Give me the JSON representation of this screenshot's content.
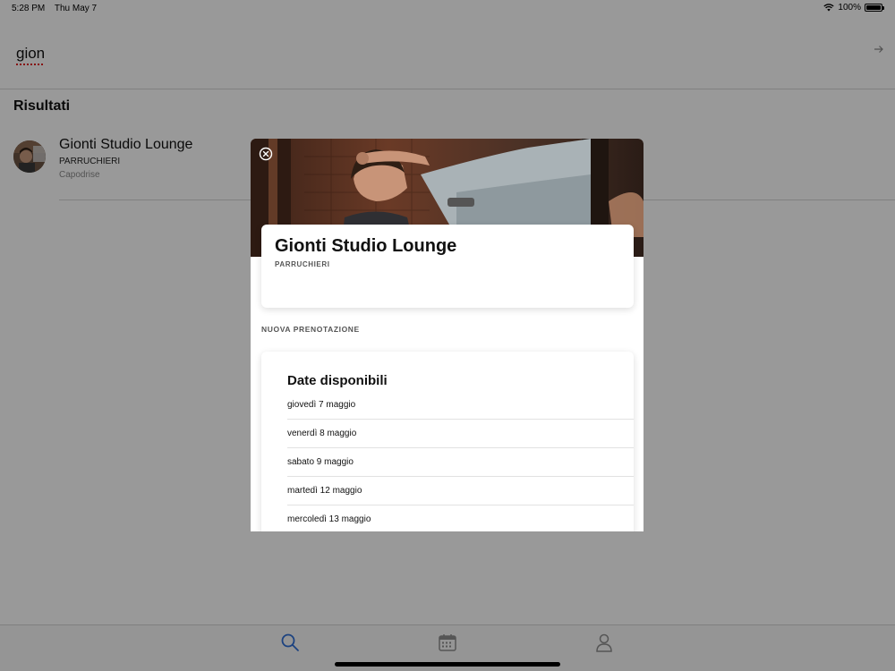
{
  "status_bar": {
    "time": "5:28 PM",
    "date": "Thu May 7",
    "battery": "100%"
  },
  "search": {
    "value": "gion",
    "submit_icon": "arrow-right-icon"
  },
  "results": {
    "title": "Risultati",
    "items": [
      {
        "name": "Gionti Studio Lounge",
        "category": "PARRUCHIERI",
        "city": "Capodrise"
      }
    ]
  },
  "modal": {
    "close_icon": "close-circle-icon",
    "title": "Gionti Studio Lounge",
    "category": "PARRUCHIERI",
    "section_label": "NUOVA PRENOTAZIONE",
    "dates_title": "Date disponibili",
    "dates": [
      "giovedì 7 maggio",
      "venerdì 8 maggio",
      "sabato 9 maggio",
      "martedì 12 maggio",
      "mercoledì 13 maggio"
    ]
  },
  "tab_bar": {
    "items": [
      {
        "icon": "search-icon",
        "active": true
      },
      {
        "icon": "calendar-icon",
        "active": false
      },
      {
        "icon": "person-icon",
        "active": false
      }
    ]
  },
  "colors": {
    "accent": "#2f6fd6",
    "inactive": "#8e8e8e",
    "spell_error": "#e02020"
  }
}
